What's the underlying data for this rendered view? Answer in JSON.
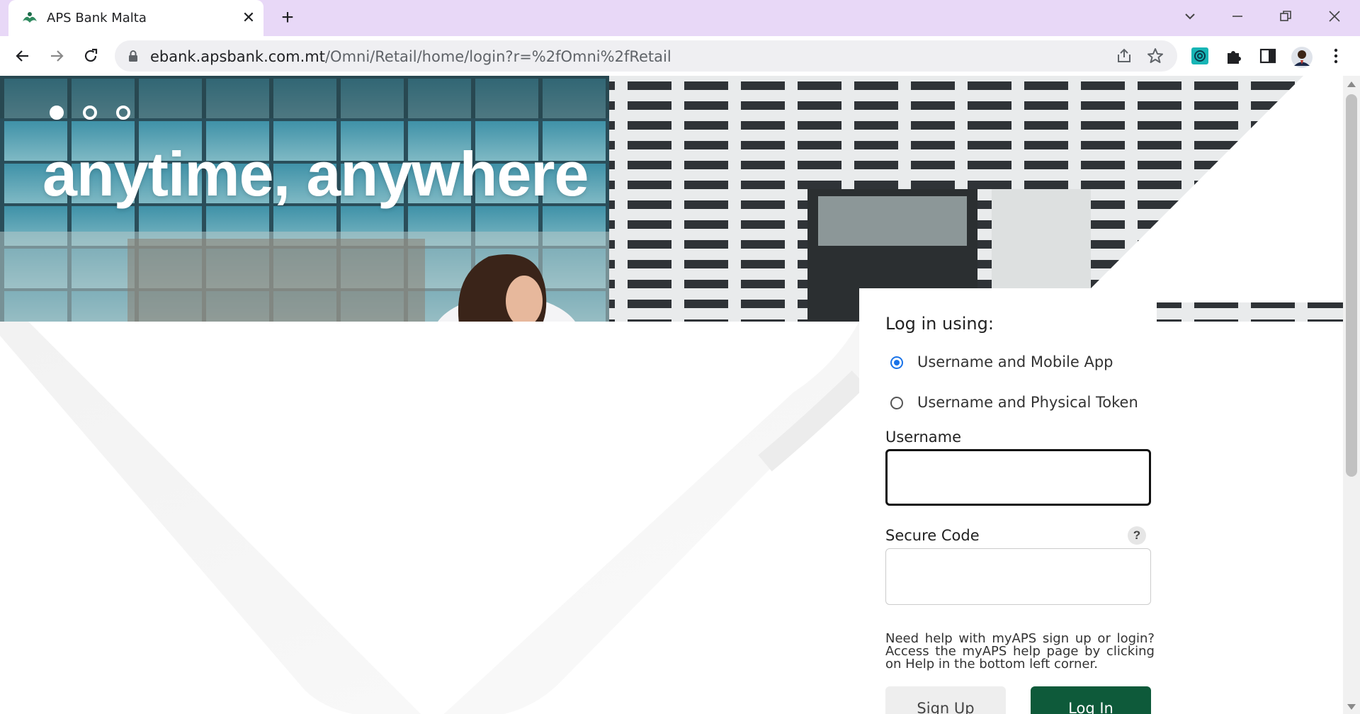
{
  "browser": {
    "tab_title": "APS Bank Malta",
    "tab_close": "✕",
    "new_tab": "+",
    "url_host": "ebank.apsbank.com.mt",
    "url_path": "/Omni/Retail/home/login?r=%2fOmni%2fRetail"
  },
  "hero": {
    "headline": "anytime, anywhere",
    "carousel_slides": 3,
    "active_slide": 1
  },
  "login": {
    "title": "Log in using:",
    "options": [
      {
        "label": "Username and Mobile App",
        "checked": true
      },
      {
        "label": "Username and Physical Token",
        "checked": false
      }
    ],
    "username_label": "Username",
    "username_value": "",
    "secure_code_label": "Secure Code",
    "secure_code_value": "",
    "help_icon": "?",
    "help_text": "Need help with myAPS sign up or login? Access the myAPS help page by clicking on Help in the bottom left corner.",
    "signup_label": "Sign Up",
    "login_label": "Log In"
  },
  "colors": {
    "tabbar": "#e8d8f7",
    "primary_button": "#0e5a3a",
    "radio_accent": "#1a73e8"
  }
}
